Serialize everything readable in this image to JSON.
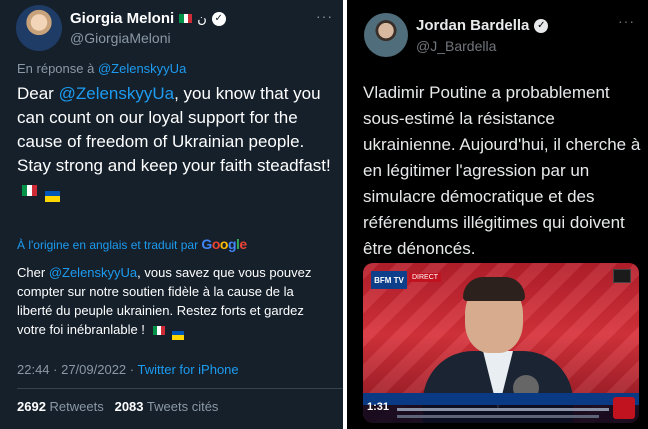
{
  "left_tweet": {
    "author_name": "Giorgia Meloni",
    "name_symbol": "ن",
    "handle": "@GiorgiaMeloni",
    "more": "···",
    "reply_prefix": "En réponse à",
    "reply_handle": "@ZelenskyyUa",
    "body_prefix": "Dear",
    "body_mention": "@ZelenskyyUa",
    "body_rest": ", you know that you can count on our loyal support for the cause of freedom of Ukrainian people. Stay strong and keep your faith steadfast!",
    "translated_label": "À l'origine en anglais et traduit par",
    "translator": "Google",
    "translation_prefix": "Cher",
    "translation_mention": "@ZelenskyyUa",
    "translation_rest": ", vous savez que vous pouvez compter sur notre soutien fidèle à la cause de la liberté du peuple ukrainien. Restez forts et gardez votre foi inébranlable !",
    "time": "22:44 · 27/09/2022 ·",
    "source": "Twitter for iPhone",
    "retweets_count": "2692",
    "retweets_label": "Retweets",
    "quotes_count": "2083",
    "quotes_label": "Tweets cités"
  },
  "right_tweet": {
    "author_name": "Jordan Bardella",
    "handle": "@J_Bardella",
    "more": "···",
    "body": "Vladimir Poutine a probablement sous-estimé la résistance ukrainienne. Aujourd'hui, il cherche à en légitimer l'agression par un simulacre démocratique et des référendums illégitimes qui doivent être dénoncés.",
    "media": {
      "channel": "BFM TV",
      "live": "DIRECT",
      "clock": "1:31"
    }
  },
  "colors": {
    "left_bg": "#15202b",
    "right_bg": "#000000",
    "link": "#1d9bf0",
    "muted": "#8b98a5"
  }
}
